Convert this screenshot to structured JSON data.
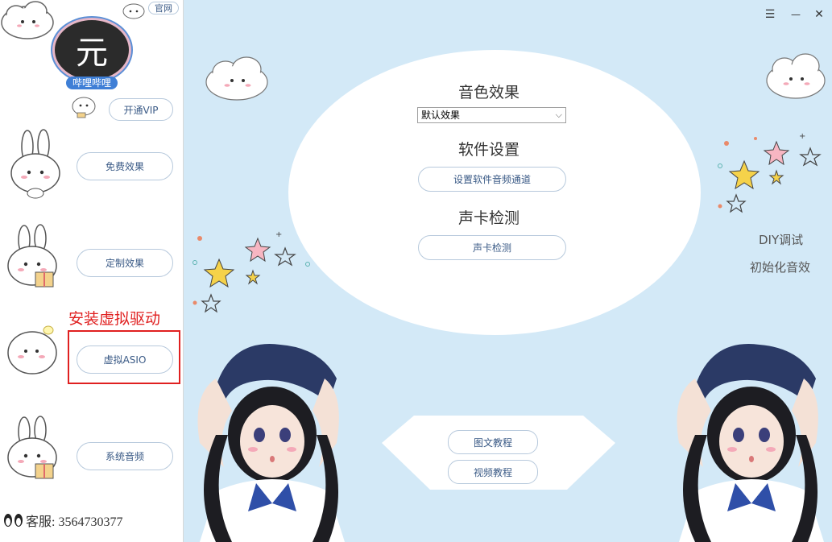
{
  "sidebar": {
    "official_site": "官网",
    "avatar_char": "元",
    "nickname": "哔哩哔哩",
    "vip_button": "开通VIP",
    "items": [
      {
        "label": "免费效果"
      },
      {
        "label": "定制效果"
      },
      {
        "label": "虚拟ASIO"
      },
      {
        "label": "系统音频"
      }
    ],
    "annotation": "安装虚拟驱动",
    "customer_service": "客服: 3564730377"
  },
  "window_controls": {
    "menu": "☰",
    "minimize": "—",
    "close": "✕"
  },
  "main": {
    "tone_effect_title": "音色效果",
    "tone_effect_select": "默认效果",
    "software_settings_title": "软件设置",
    "software_settings_button": "设置软件音频通道",
    "soundcard_title": "声卡检测",
    "soundcard_button": "声卡检测",
    "tutorial_text_button": "图文教程",
    "tutorial_video_button": "视频教程",
    "diy_link": "DIY调试",
    "init_link": "初始化音效"
  },
  "colors": {
    "accent": "#3a5a86",
    "main_bg": "#d3e9f7",
    "highlight": "#e02020"
  }
}
